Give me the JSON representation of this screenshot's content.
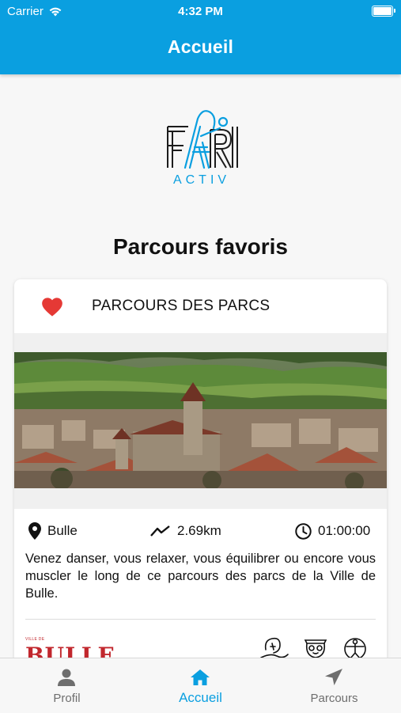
{
  "status": {
    "carrier": "Carrier",
    "time": "4:32 PM",
    "icons": [
      "wifi-icon",
      "battery-icon"
    ]
  },
  "nav": {
    "title": "Accueil"
  },
  "logo": {
    "text": "ACTIV",
    "brand_color": "#0a9fe0"
  },
  "section": {
    "title": "Parcours favoris"
  },
  "card": {
    "favorite": true,
    "title": "PARCOURS DES PARCS",
    "location": "Bulle",
    "distance": "2.69km",
    "duration": "01:00:00",
    "description": "Venez danser, vous relaxer, vous équilibrer ou encore vous muscler le long de ce parcours des parcs de la Ville de Bulle.",
    "partner_logo": {
      "small": "VILLE DE",
      "word": "BULLE"
    },
    "activity_icons": [
      "dance-icon",
      "relax-icon",
      "fitness-icon"
    ]
  },
  "tabs": [
    {
      "label": "Profil",
      "icon": "person-icon",
      "active": false
    },
    {
      "label": "Accueil",
      "icon": "home-icon",
      "active": true
    },
    {
      "label": "Parcours",
      "icon": "navigation-arrow-icon",
      "active": false
    }
  ],
  "colors": {
    "accent": "#0a9fe0",
    "heart": "#e53935",
    "bulle_red": "#c1272d"
  }
}
